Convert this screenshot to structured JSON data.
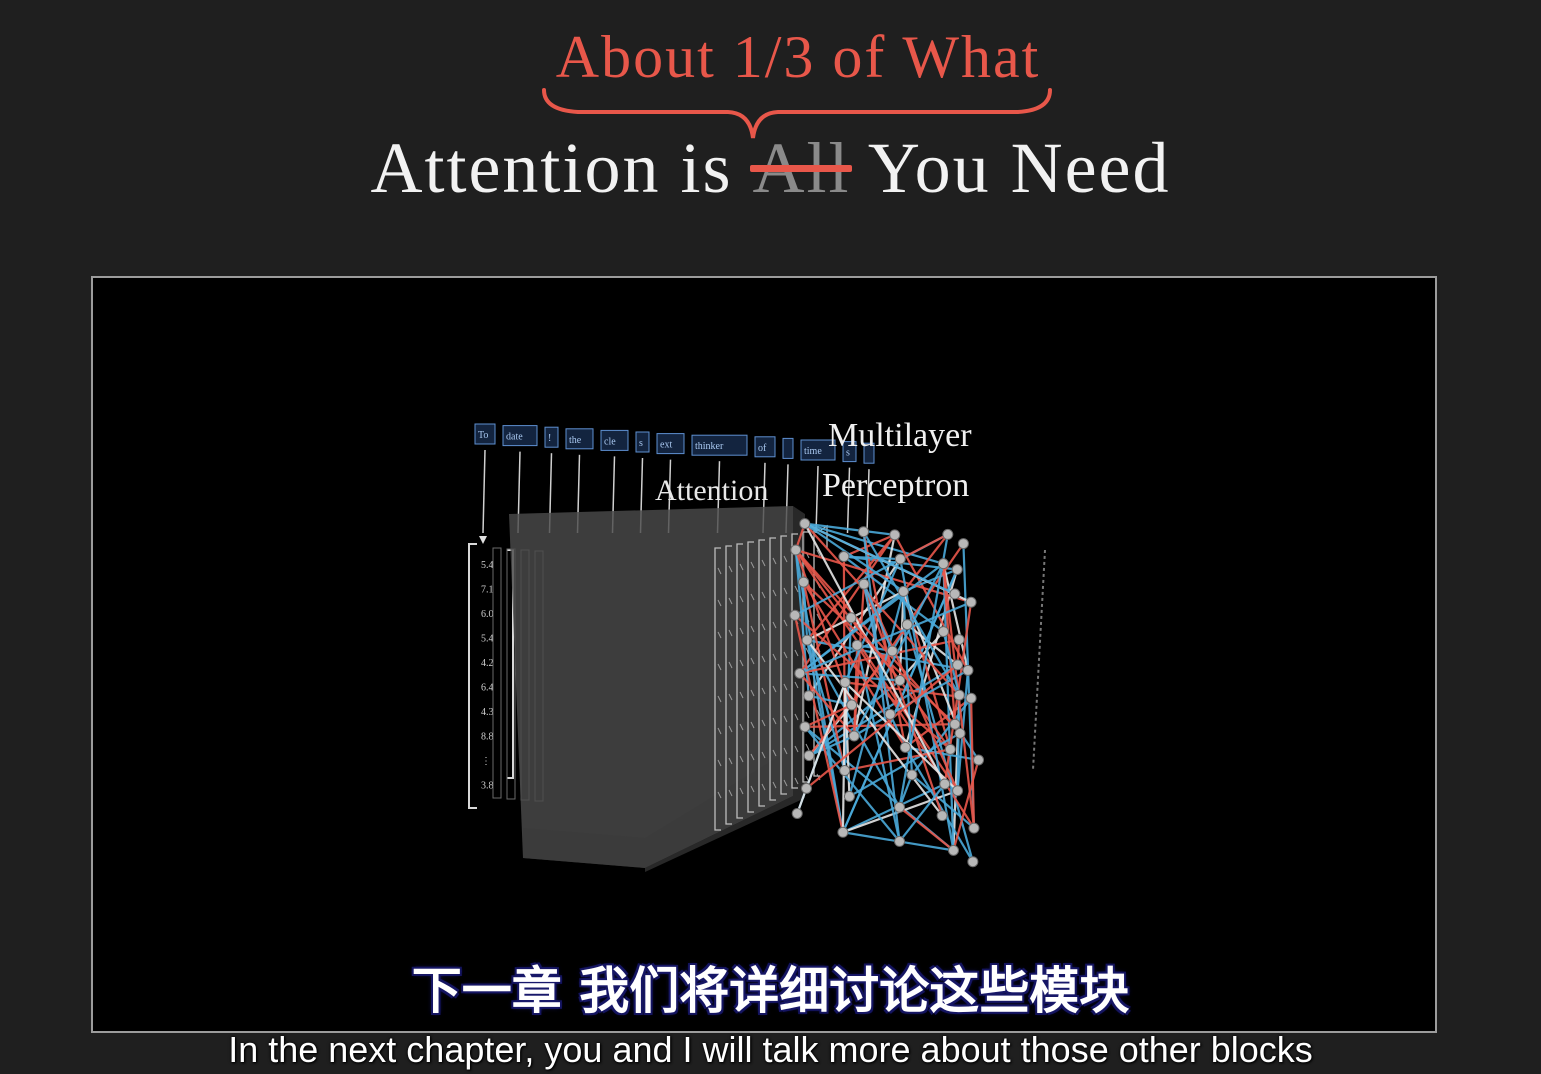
{
  "headline": {
    "top": "About 1/3 of What",
    "pre": "Attention is",
    "struck": "All",
    "post": "You Need"
  },
  "diagram": {
    "tokens": [
      "To",
      "date",
      "!",
      "the",
      "cle",
      "s",
      "ext",
      "thinker",
      "of",
      "",
      "time",
      "s",
      ""
    ],
    "attention_label": "Attention",
    "mlp_label_line1": "Multilayer",
    "mlp_label_line2": "Perceptron",
    "vector_values": [
      "5.4",
      "7.1",
      "6.0",
      "5.4",
      "4.2",
      "6.4",
      "4.3",
      "8.8",
      "⋮",
      "3.8"
    ]
  },
  "subtitles": {
    "zh": "下一章  我们将详细讨论这些模块",
    "en": "In the next chapter, you and I will talk more about those other blocks"
  },
  "colors": {
    "accent_red": "#e8574a",
    "edge_blue": "#4aa8d8",
    "edge_red": "#e8574a",
    "frame_bg": "#000000",
    "page_bg": "#1f1f1f"
  }
}
